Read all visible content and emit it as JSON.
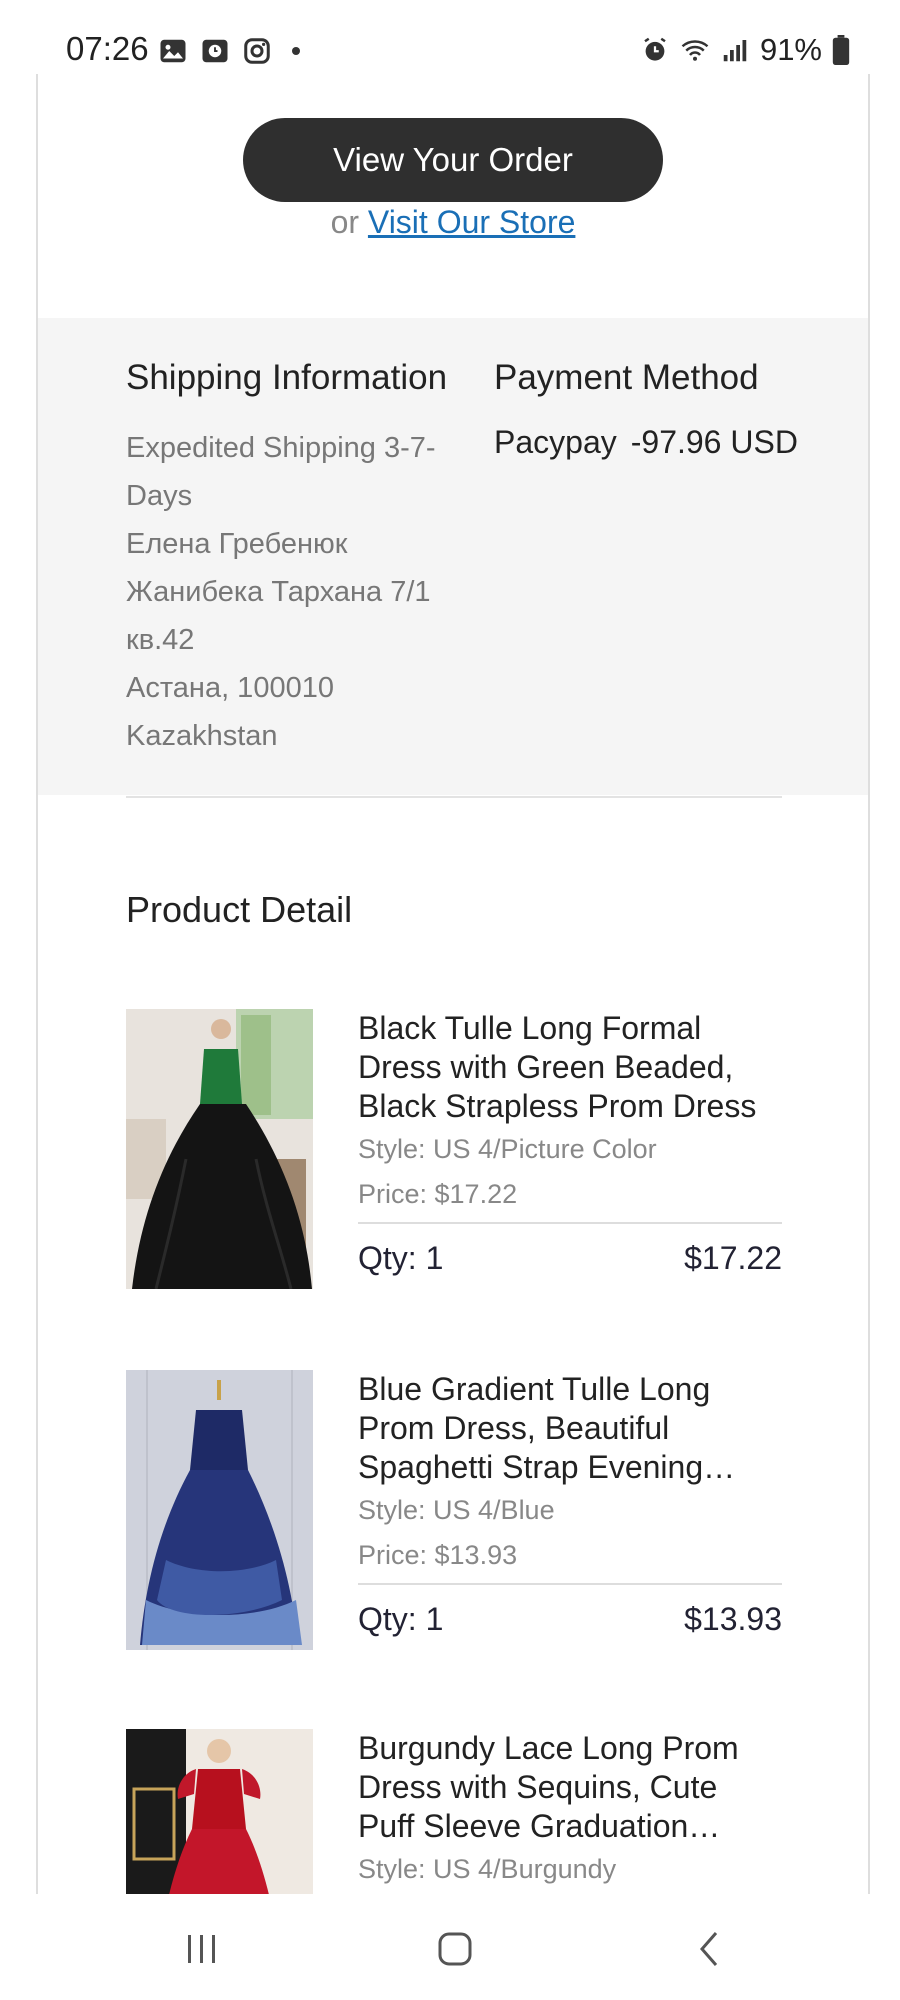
{
  "status_bar": {
    "time": "07:26",
    "battery": "91%",
    "icons_left": [
      "gallery-icon",
      "clock-app-icon",
      "instagram-icon",
      "dot-icon"
    ],
    "icons_right": [
      "alarm-icon",
      "wifi-icon",
      "signal-icon",
      "battery-icon"
    ]
  },
  "order": {
    "view_order_label": "View Your Order",
    "or_text": "or",
    "visit_store_label": "Visit Our Store"
  },
  "shipping": {
    "title": "Shipping Information",
    "method": "Expedited Shipping 3-7-Days",
    "name": "Елена Гребенюк",
    "street": "Жанибека Тархана 7/1 кв.42",
    "city": "Астана, 100010",
    "country": "Kazakhstan"
  },
  "payment": {
    "title": "Payment Method",
    "method": "Pacypay",
    "amount": "-97.96 USD"
  },
  "products": {
    "title": "Product Detail",
    "items": [
      {
        "name": "Black Tulle Long Formal Dress with Green Beaded, Black Strapless Prom Dress",
        "style": "Style: US 4/Picture Color",
        "price": "Price: $17.22",
        "qty": "Qty: 1",
        "total": "$17.22"
      },
      {
        "name": "Blue Gradient Tulle Long Prom Dress, Beautiful Spaghetti Strap Evening…",
        "style": "Style: US 4/Blue",
        "price": "Price: $13.93",
        "qty": "Qty: 1",
        "total": "$13.93"
      },
      {
        "name": "Burgundy Lace Long Prom Dress with Sequins, Cute Puff Sleeve Graduation…",
        "style": "Style: US 4/Burgundy"
      }
    ]
  },
  "colors": {
    "button_bg": "#2f2f2f",
    "link": "#1a6fb6",
    "section_bg": "#f5f5f5"
  }
}
